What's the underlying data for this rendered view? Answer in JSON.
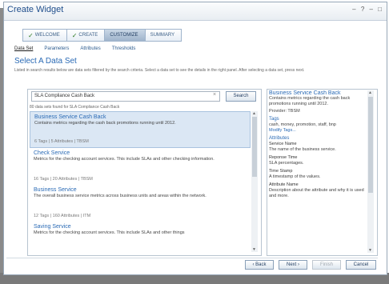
{
  "window": {
    "title": "Create Widget",
    "controls": "– ? – □"
  },
  "wizard": {
    "steps": [
      {
        "label": "WELCOME",
        "done": true
      },
      {
        "label": "CREATE",
        "done": true
      },
      {
        "label": "CUSTOMIZE",
        "active": true
      },
      {
        "label": "SUMMARY"
      }
    ]
  },
  "subtabs": [
    "Data Set",
    "Parameters",
    "Attributes",
    "Thresholds"
  ],
  "section": {
    "title": "Select A Data Set",
    "description": "Listed in search results below are data sets filtered by the search criteria. Select a data set to see the details in the right panel. After selecting a data set, press next."
  },
  "search": {
    "value": "SLA Compliance Cash Back",
    "button": "Search",
    "found_text": "80 data sets found for SLA Compliance Cash Back"
  },
  "results": [
    {
      "name": "Business Service Cash Back",
      "desc": "Contains metrics regarding the cash back promotions running until 2012.",
      "meta": "6 Tags | 5 Attributes | TBSM",
      "selected": true
    },
    {
      "name": "Check Service",
      "desc": "Metrics for the checking account services. This include SLAs and other checking information.",
      "meta": "16 Tags | 20 Attributes | TBSM"
    },
    {
      "name": "Business Service",
      "desc": "The overall business service metrics across business units and areas within the network.",
      "meta": "12 Tags | 160 Attributes | ITM"
    },
    {
      "name": "Saving Service",
      "desc": "Metrics for the checking account services. This include SLAs and other things",
      "meta": ""
    }
  ],
  "details": {
    "title": "Business Service Cash Back",
    "desc": "Contains metrics regarding the cash back promotions running until 2012.",
    "provider": "Provider: TBSM",
    "tags_heading": "Tags",
    "tags": "cash, money, promotion, staff, bnp",
    "modify_tags": "Modify Tags...",
    "attributes_heading": "Attributes",
    "attributes": [
      {
        "name": "Service Name",
        "desc": "The name of the business service."
      },
      {
        "name": "Reponse Time",
        "desc": "SLA percentages."
      },
      {
        "name": "Time Stamp",
        "desc": "A timestamp of the values."
      },
      {
        "name": "Attribute Name",
        "desc": "Description about the attribute and why it is used and more."
      }
    ]
  },
  "footer": {
    "back": "‹ Back",
    "next": "Next ›",
    "finish": "Finish",
    "cancel": "Cancel"
  }
}
